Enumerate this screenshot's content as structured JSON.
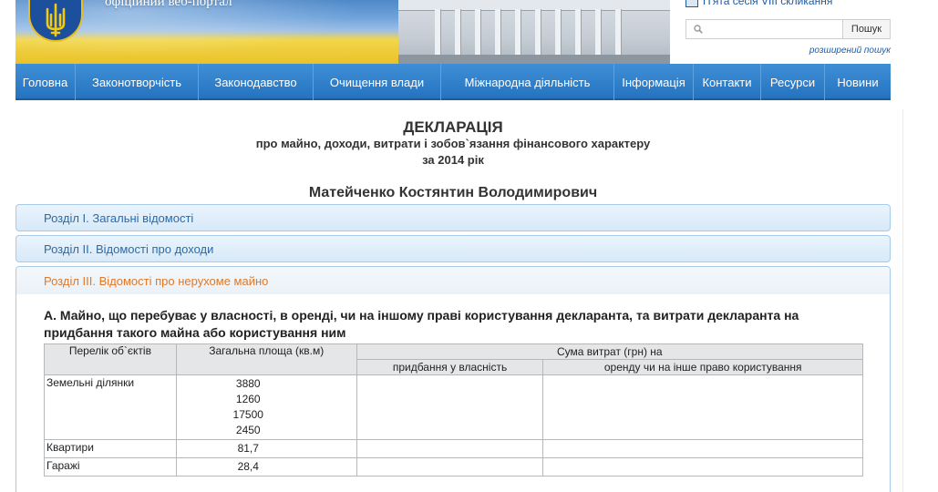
{
  "header": {
    "portal_title": "офіційний веб-портал",
    "session_link": "П'ята сесія VIII скликання",
    "search": {
      "placeholder": "",
      "button_label": "Пошук",
      "advanced_label": "розширений пошук"
    }
  },
  "nav": {
    "items": [
      {
        "label": "Головна"
      },
      {
        "label": "Законотворчість"
      },
      {
        "label": "Законодавство"
      },
      {
        "label": "Очищення влади"
      },
      {
        "label": "Міжнародна діяльність"
      },
      {
        "label": "Інформація"
      },
      {
        "label": "Контакти"
      },
      {
        "label": "Ресурси"
      },
      {
        "label": "Новини"
      }
    ]
  },
  "declaration": {
    "title": "ДЕКЛАРАЦІЯ",
    "subtitle": "про майно, доходи, витрати і зобов`язання фінансового характеру",
    "year": "за 2014 рік",
    "person": "Матейченко Костянтин Володимирович"
  },
  "sections": [
    {
      "label": "Розділ І. Загальні відомості"
    },
    {
      "label": "Розділ ІІ. Відомості про доходи"
    },
    {
      "label": "Розділ ІІІ. Відомості про нерухоме майно"
    }
  ],
  "section3": {
    "a_title": "А. Майно, що перебуває у власності, в оренді, чи на іншому праві користування декларанта, та витрати декларанта на придбання такого майна або користування ним",
    "table": {
      "headers": {
        "objects": "Перелік об`єктів",
        "area": "Загальна площа (кв.м)",
        "expenses": "Сума витрат (грн) на",
        "purchase": "придбання у власність",
        "rent": "оренду чи на інше право користування"
      },
      "rows": [
        {
          "object": "Земельні ділянки",
          "areas": [
            "3880",
            "1260",
            "17500",
            "2450"
          ]
        },
        {
          "object": "Квартири",
          "areas": [
            "81,7"
          ]
        },
        {
          "object": "Гаражі",
          "areas": [
            "28,4"
          ]
        }
      ]
    }
  },
  "colors": {
    "nav_blue": "#2573bf",
    "section_link": "#2e6aa7",
    "active_section": "#e0782a"
  }
}
